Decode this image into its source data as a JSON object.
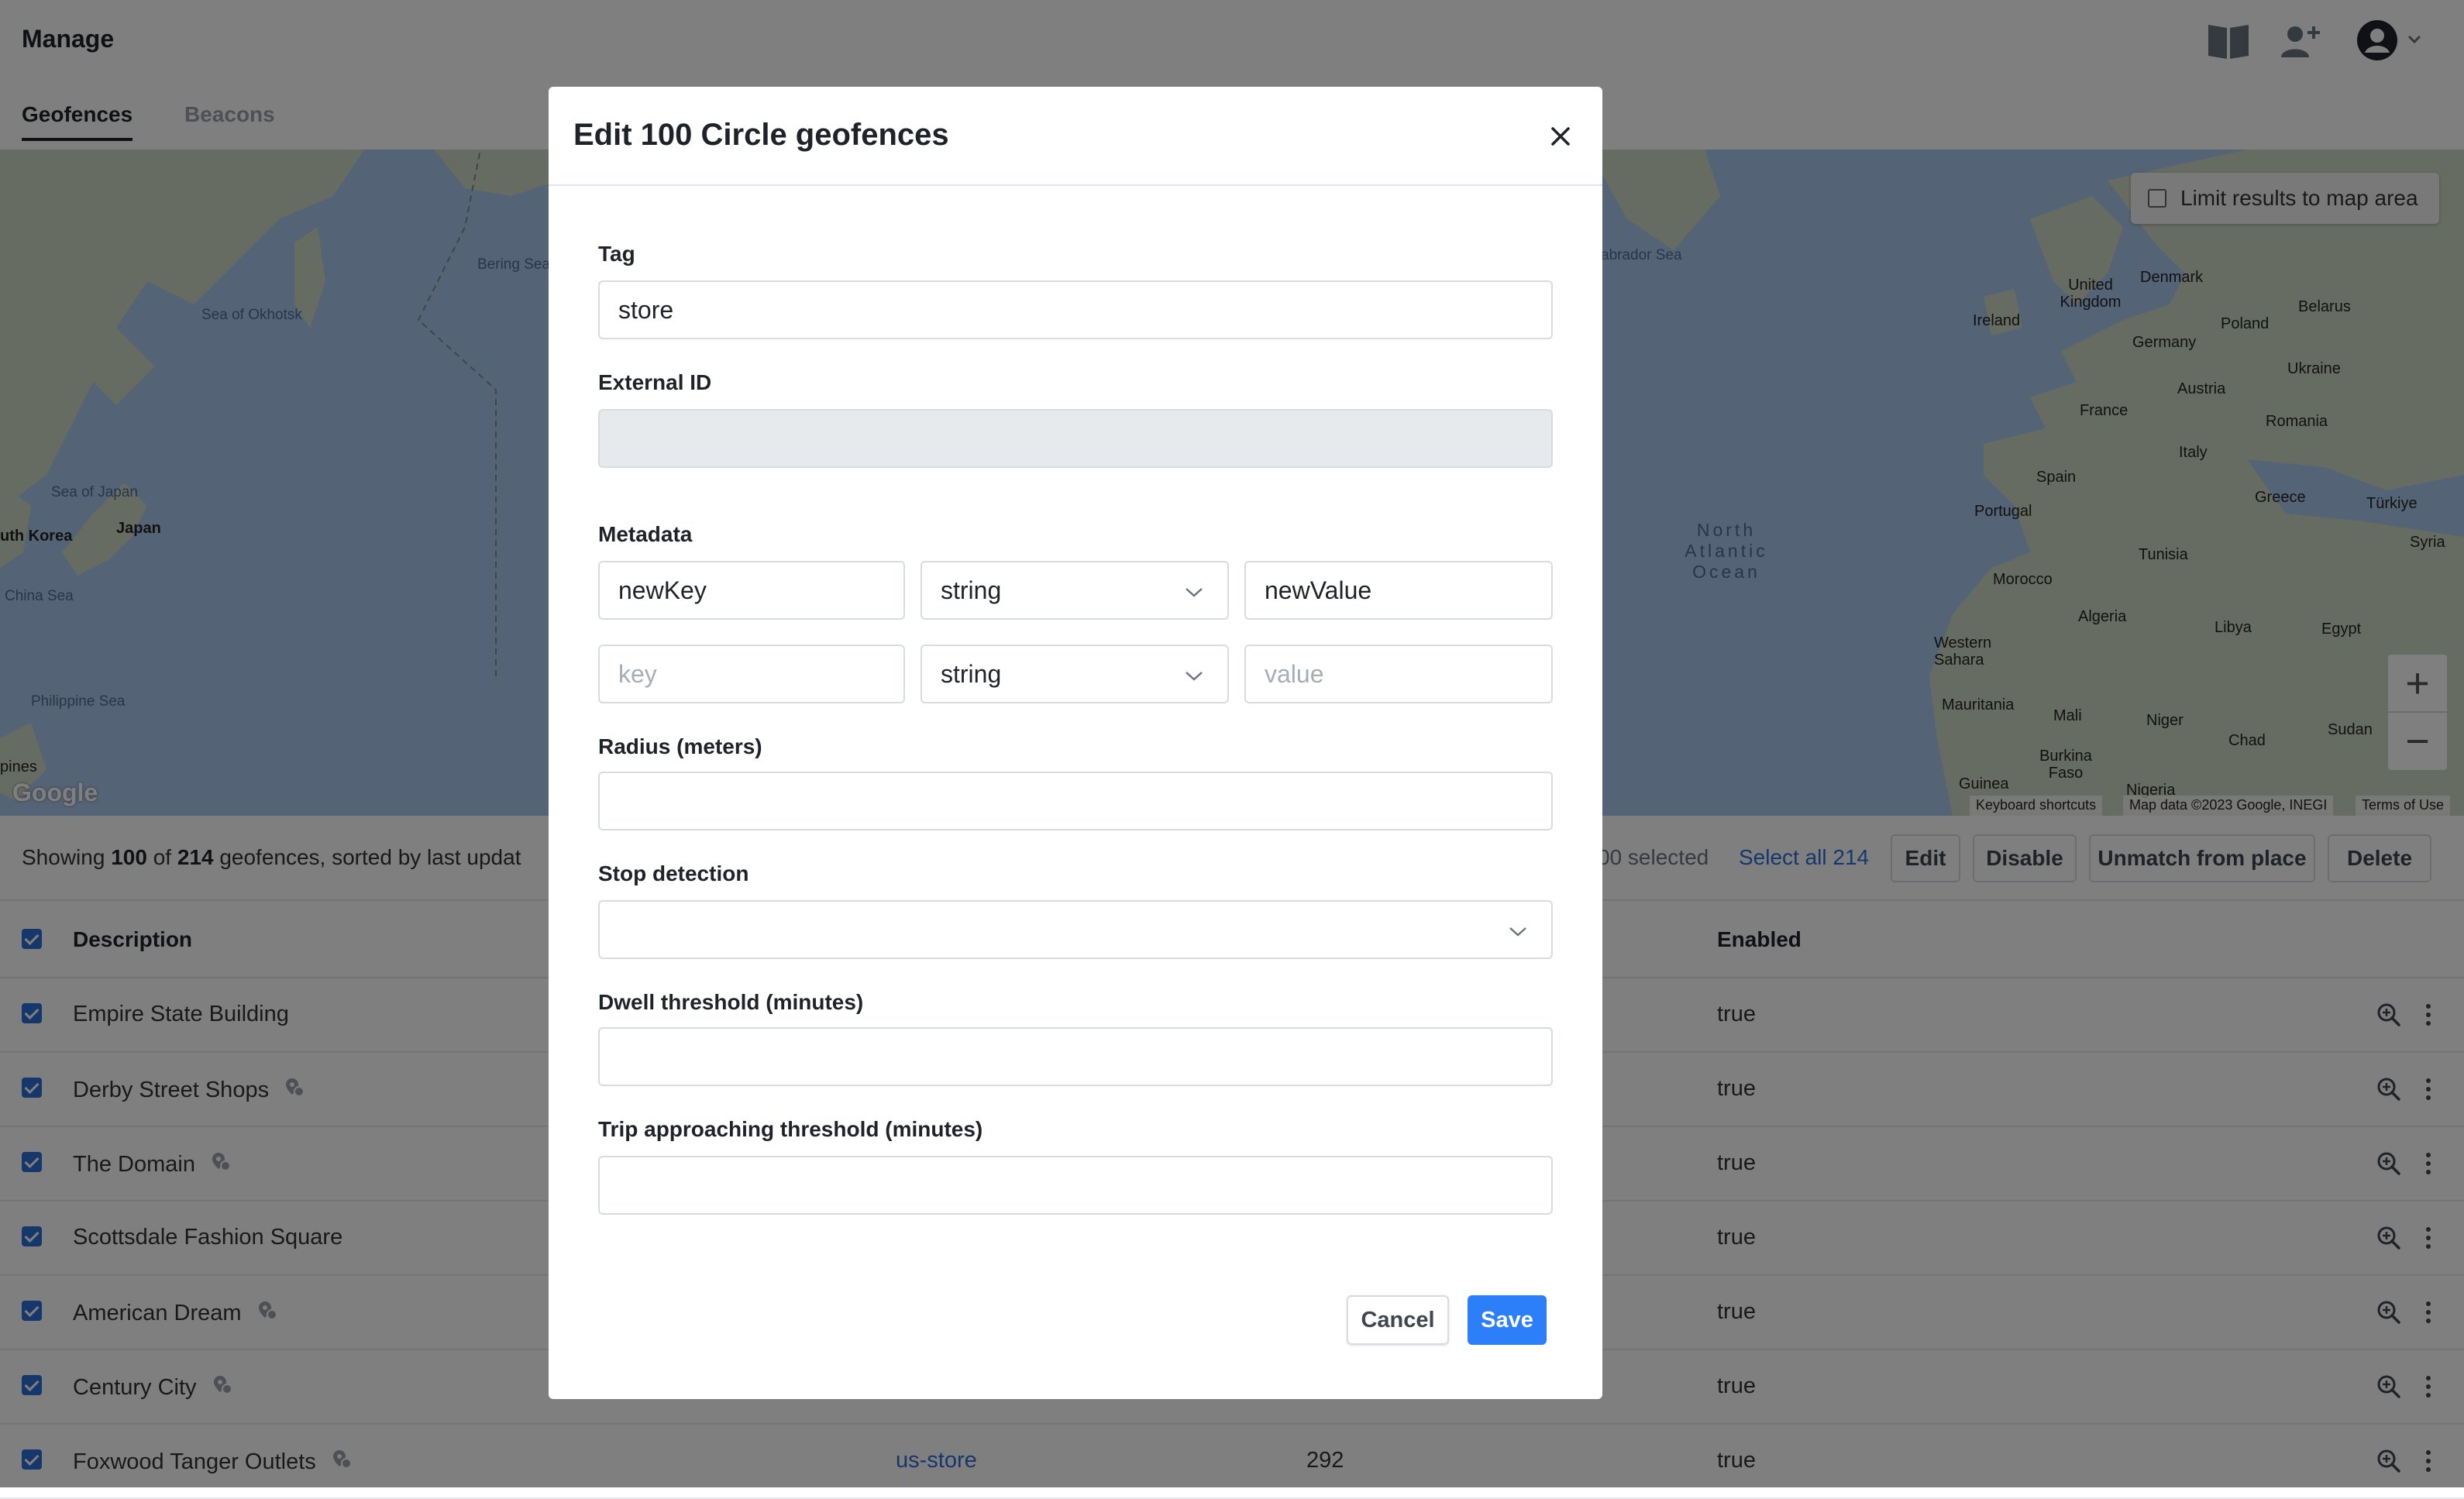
{
  "header": {
    "title": "Manage",
    "icons": [
      "docs-book-icon",
      "add-user-icon",
      "account-avatar-icon",
      "chevron-down-icon"
    ]
  },
  "tabs": [
    {
      "label": "Geofences",
      "active": true
    },
    {
      "label": "Beacons",
      "active": false
    }
  ],
  "map": {
    "limit_checkbox_label": "Limit results to map area",
    "limit_checked": false,
    "zoom_in": "+",
    "zoom_out": "−",
    "logo": "Google",
    "footer": {
      "shortcuts": "Keyboard shortcuts",
      "data": "Map data ©2023 Google, INEGI",
      "terms": "Terms of Use"
    },
    "labels": {
      "sea_of_okhotsk": "Sea of Okhotsk",
      "bering_sea": "Bering Sea",
      "sea_of_japan": "Sea of Japan",
      "japan": "Japan",
      "south_korea": "uth Korea",
      "china_sea": "China Sea",
      "philippine_sea": "Philippine Sea",
      "philippines": "pines",
      "labrador_sea": "abrador Sea",
      "north_atlantic_ocean": "North Atlantic Ocean",
      "united_kingdom": "United Kingdom",
      "denmark": "Denmark",
      "belarus": "Belarus",
      "ireland": "Ireland",
      "poland": "Poland",
      "germany": "Germany",
      "ukraine": "Ukraine",
      "austria": "Austria",
      "france": "France",
      "romania": "Romania",
      "italy": "Italy",
      "spain": "Spain",
      "portugal": "Portugal",
      "greece": "Greece",
      "turkiye": "Türkiye",
      "syria": "Syria",
      "tunisia": "Tunisia",
      "morocco": "Morocco",
      "algeria": "Algeria",
      "libya": "Libya",
      "egypt": "Egypt",
      "western_sahara": "Western Sahara",
      "mauritania": "Mauritania",
      "mali": "Mali",
      "niger": "Niger",
      "chad": "Chad",
      "sudan": "Sudan",
      "burkina_faso": "Burkina Faso",
      "guinea": "Guinea",
      "nigeria": "Nigeria"
    }
  },
  "results": {
    "prefix": "Showing",
    "shown": "100",
    "of": "of",
    "total": "214",
    "suffix": "geofences, sorted by last updat",
    "selected": "00 selected",
    "select_all": "Select all 214",
    "actions": [
      "Edit",
      "Disable",
      "Unmatch from place",
      "Delete"
    ]
  },
  "table": {
    "columns": {
      "description": "Description",
      "enabled": "Enabled"
    },
    "rows": [
      {
        "description": "Empire State Building",
        "has_place": false,
        "enabled": "true",
        "tag": "",
        "value": ""
      },
      {
        "description": "Derby Street Shops",
        "has_place": true,
        "enabled": "true",
        "tag": "",
        "value": ""
      },
      {
        "description": "The Domain",
        "has_place": true,
        "enabled": "true",
        "tag": "",
        "value": ""
      },
      {
        "description": "Scottsdale Fashion Square",
        "has_place": false,
        "enabled": "true",
        "tag": "",
        "value": ""
      },
      {
        "description": "American Dream",
        "has_place": true,
        "enabled": "true",
        "tag": "",
        "value": ""
      },
      {
        "description": "Century City",
        "has_place": true,
        "enabled": "true",
        "tag": "",
        "value": ""
      },
      {
        "description": "Foxwood Tanger Outlets",
        "has_place": true,
        "enabled": "true",
        "tag": "us-store",
        "value": "292"
      }
    ]
  },
  "modal": {
    "title": "Edit 100 Circle geofences",
    "fields": {
      "tag": {
        "label": "Tag",
        "value": "store"
      },
      "external_id": {
        "label": "External ID",
        "value": ""
      },
      "metadata": {
        "label": "Metadata",
        "rows": [
          {
            "key": "newKey",
            "type": "string",
            "value": "newValue"
          },
          {
            "key_placeholder": "key",
            "type": "string",
            "value_placeholder": "value"
          }
        ]
      },
      "radius": {
        "label": "Radius (meters)",
        "value": ""
      },
      "stop_detection": {
        "label": "Stop detection",
        "value": ""
      },
      "dwell_threshold": {
        "label": "Dwell threshold (minutes)",
        "value": ""
      },
      "trip_threshold": {
        "label": "Trip approaching threshold (minutes)",
        "value": ""
      }
    },
    "cancel_label": "Cancel",
    "save_label": "Save"
  },
  "colors": {
    "accent": "#2d7ff9",
    "link": "#2a6fd6",
    "map_water": "#a9c7ea",
    "map_land": "#cfd8c4",
    "overlay": "rgba(0,0,0,0.5)"
  }
}
